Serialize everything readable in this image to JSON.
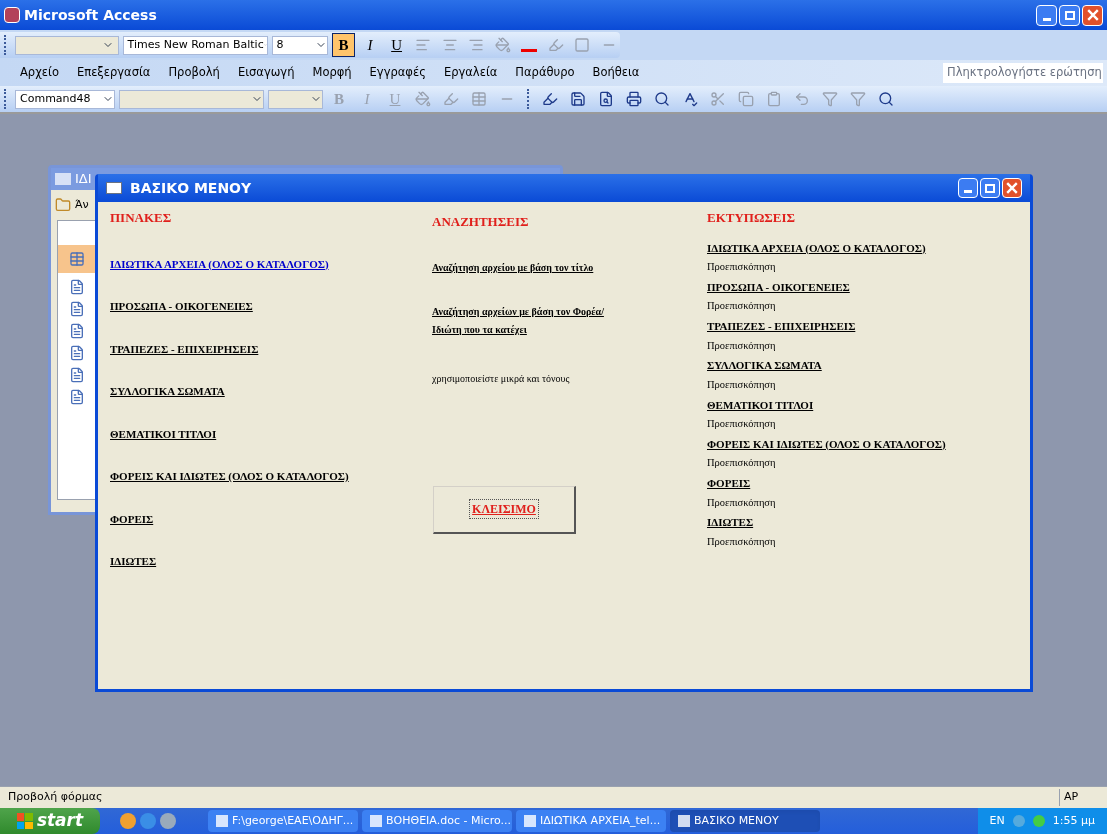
{
  "app": {
    "title": "Microsoft Access"
  },
  "format_toolbar": {
    "font": "Times New Roman Baltic",
    "size": "8",
    "buttons": [
      {
        "label": "B",
        "selected": true
      },
      {
        "label": "I",
        "selected": false
      },
      {
        "label": "U",
        "selected": false
      }
    ]
  },
  "menu": [
    "Αρχείο",
    "Επεξεργασία",
    "Προβολή",
    "Εισαγωγή",
    "Μορφή",
    "Εγγραφές",
    "Εργαλεία",
    "Παράθυρο",
    "Βοήθεια"
  ],
  "help_box": {
    "placeholder": "Πληκτρολογήστε ερώτηση"
  },
  "form_toolbar": {
    "object_combo": "Command48",
    "buttons": [
      {
        "label": "B",
        "disabled": true
      },
      {
        "label": "I",
        "disabled": true
      },
      {
        "label": "U",
        "disabled": true
      }
    ]
  },
  "background_window": {
    "title": "ΙΔΙ",
    "toolbar_button": "Άν"
  },
  "form": {
    "title": "ΒΑΣΙΚΟ ΜΕΝΟΥ",
    "tables": {
      "heading": "ΠΙΝΑΚΕΣ",
      "items": [
        {
          "label": "ΙΔΙΩΤΙΚΑ ΑΡΧΕΙΑ (ΟΛΟΣ Ο ΚΑΤΑΛΟΓΟΣ)",
          "color": "#0000cc"
        },
        {
          "label": "ΠΡΟΣΩΠΑ - ΟΙΚΟΓΕΝΕΙΕΣ",
          "color": "#000000"
        },
        {
          "label": "ΤΡΑΠΕΖΕΣ - ΕΠΙΧΕΙΡΗΣΕΙΣ",
          "color": "#000000"
        },
        {
          "label": "ΣΥΛΛΟΓΙΚΑ ΣΩΜΑΤΑ",
          "color": "#000000"
        },
        {
          "label": "ΘΕΜΑΤΙΚΟΙ ΤΙΤΛΟΙ",
          "color": "#000000"
        },
        {
          "label": "ΦΟΡΕΙΣ ΚΑΙ ΙΔΙΩΤΕΣ (ΟΛΟΣ Ο ΚΑΤΑΛΟΓΟΣ)",
          "color": "#000000"
        },
        {
          "label": "ΦΟΡΕΙΣ",
          "color": "#000000"
        },
        {
          "label": "ΙΔΙΩΤΕΣ",
          "color": "#000000"
        }
      ]
    },
    "searches": {
      "heading": "ΑΝΑΖΗΤΗΣΕΙΣ",
      "items": [
        "Αναζήτηση αρχείου με βάση τον τίτλο",
        "Αναζήτηση αρχείων με βάση τον Φορέα/Ιδιώτη που τα κατέχει"
      ],
      "note": "χρησιμοποιείστε μικρά και τόνους",
      "close_button": "ΚΛΕΙΣΙΜΟ"
    },
    "reports": {
      "heading": "ΕΚΤΥΠΩΣΕΙΣ",
      "items": [
        {
          "label": "ΙΔΙΩΤΙΚΑ ΑΡΧΕΙΑ (ΟΛΟΣ Ο ΚΑΤΑΛΟΓΟΣ)",
          "preview": "Προεπισκόπηση"
        },
        {
          "label": "ΠΡΟΣΩΠΑ - ΟΙΚΟΓΕΝΕΙΕΣ",
          "preview": "Προεπισκόπηση"
        },
        {
          "label": "ΤΡΑΠΕΖΕΣ - ΕΠΙΧΕΙΡΗΣΕΙΣ",
          "preview": "Προεπισκόπηση"
        },
        {
          "label": "ΣΥΛΛΟΓΙΚΑ ΣΩΜΑΤΑ",
          "preview": "Προεπισκόπηση"
        },
        {
          "label": "ΘΕΜΑΤΙΚΟΙ ΤΙΤΛΟΙ",
          "preview": "Προεπισκόπηση"
        },
        {
          "label": "ΦΟΡΕΙΣ ΚΑΙ ΙΔΙΩΤΕΣ (ΟΛΟΣ Ο ΚΑΤΑΛΟΓΟΣ)",
          "preview": "Προεπισκόπηση"
        },
        {
          "label": "ΦΟΡΕΙΣ",
          "preview": "Προεπισκόπηση"
        },
        {
          "label": "ΙΔΙΩΤΕΣ",
          "preview": "Προεπισκόπηση"
        }
      ]
    }
  },
  "status_bar": {
    "text": "Προβολή φόρμας",
    "indicator": "AP"
  },
  "taskbar": {
    "start": "start",
    "tasks": [
      {
        "label": "F:\\george\\ΕΑΕ\\ΟΔΗΓ...",
        "selected": false
      },
      {
        "label": "ΒΟΗΘΕΙΑ.doc - Micro...",
        "selected": false
      },
      {
        "label": "ΙΔΙΩΤΙΚΑ ΑΡΧΕΙΑ_tel...",
        "selected": false
      },
      {
        "label": "ΒΑΣΙΚΟ ΜΕΝΟΥ",
        "selected": true
      }
    ],
    "language": "EN",
    "clock": "1:55 μμ"
  }
}
